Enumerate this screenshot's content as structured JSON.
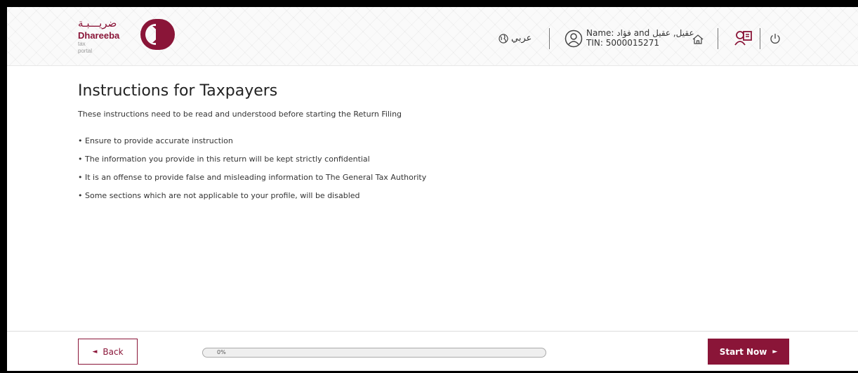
{
  "header": {
    "logo": {
      "arabic": "ضريـــبـة",
      "name": "Dhareeba",
      "subtitle": "tax portal"
    },
    "language_label": "عربي",
    "user": {
      "name": "Name: فؤاد and عقيل, عقيل",
      "tin": "TIN: 5000015271"
    }
  },
  "page": {
    "title": "Instructions for Taxpayers",
    "subtitle": "These instructions need to be read and understood before starting the Return Filing",
    "instructions": [
      "Ensure to provide accurate instruction",
      "The information you provide in this return will be kept strictly confidential",
      "It is an offense to provide false and misleading information to The General Tax Authority",
      "Some sections which are not applicable to your profile, will be disabled"
    ]
  },
  "footer": {
    "back_label": "Back",
    "progress": {
      "value": 0,
      "label": "0%"
    },
    "start_label": "Start Now"
  },
  "colors": {
    "brand": "#8a1538",
    "text": "#333333"
  },
  "icons": [
    "globe-icon",
    "user-icon",
    "home-icon",
    "guide-icon",
    "power-icon",
    "caret-left-icon",
    "caret-right-icon"
  ]
}
